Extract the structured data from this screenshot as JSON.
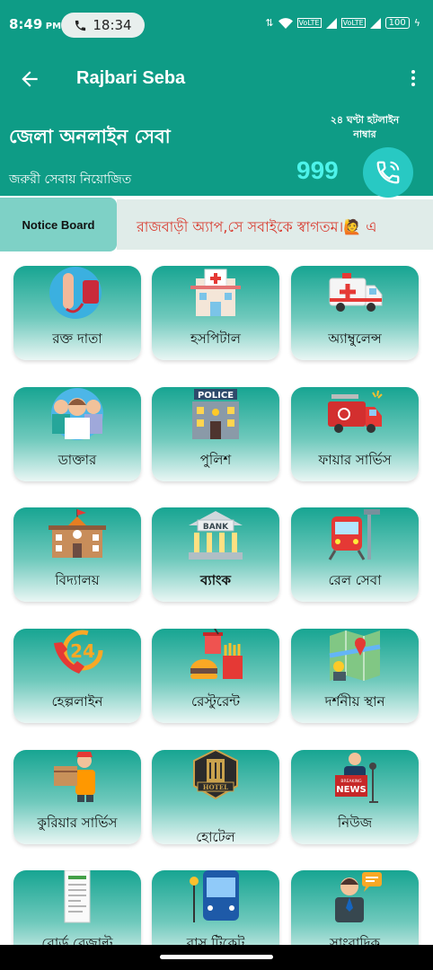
{
  "status": {
    "time": "8:49",
    "ampm": "PM",
    "call_timer": "18:34",
    "net1": "VoLTE",
    "net2": "VoLTE",
    "battery": "100"
  },
  "appbar": {
    "title": "Rajbari Seba",
    "back_icon": "arrow-left-icon",
    "menu_icon": "more-vert-icon"
  },
  "header": {
    "title": "জেলা অনলাইন সেবা",
    "subtitle": "জরুরী সেবায় নিয়োজিত",
    "hotline_label_1": "২৪ ঘণ্টা হটলাইন",
    "hotline_label_2": "নাম্বার",
    "hotline_number": "999"
  },
  "notice": {
    "label": "Notice Board",
    "text": "রাজবাড়ী অ্যাপ,সে সবাইকে স্বাগতম।🙋 এ"
  },
  "services": [
    {
      "label": "রক্ত দাতা",
      "icon": "blood-donor-icon"
    },
    {
      "label": "হসপিটাল",
      "icon": "hospital-icon"
    },
    {
      "label": "অ্যাম্বুলেন্স",
      "icon": "ambulance-icon"
    },
    {
      "label": "ডাক্তার",
      "icon": "doctor-icon"
    },
    {
      "label": "পুলিশ",
      "icon": "police-icon"
    },
    {
      "label": "ফায়ার সার্ভিস",
      "icon": "fire-truck-icon"
    },
    {
      "label": "বিদ্যালয়",
      "icon": "school-icon"
    },
    {
      "label": "ব্যাংক",
      "icon": "bank-icon"
    },
    {
      "label": "রেল সেবা",
      "icon": "train-icon"
    },
    {
      "label": "হেল্পলাইন",
      "icon": "helpline-icon"
    },
    {
      "label": "রেস্টুরেন্ট",
      "icon": "restaurant-icon"
    },
    {
      "label": "দর্শনীয় স্থান",
      "icon": "map-icon"
    },
    {
      "label": "কুরিয়ার সার্ভিস",
      "icon": "courier-icon"
    },
    {
      "label": "হোটেল",
      "icon": "hotel-icon"
    },
    {
      "label": "নিউজ",
      "icon": "news-icon"
    },
    {
      "label": "বোর্ড রেজাল্ট",
      "icon": "board-result-icon"
    },
    {
      "label": "বাস টিকেট",
      "icon": "bus-icon"
    },
    {
      "label": "সাংবাদিক",
      "icon": "journalist-icon"
    }
  ],
  "icon_labels": {
    "police_sign": "POLICE",
    "bank_sign": "BANK",
    "helpline_number": "24",
    "hotel_sign": "HOTEL",
    "news_sign": "NEWS",
    "news_breaking": "BREAKING"
  }
}
